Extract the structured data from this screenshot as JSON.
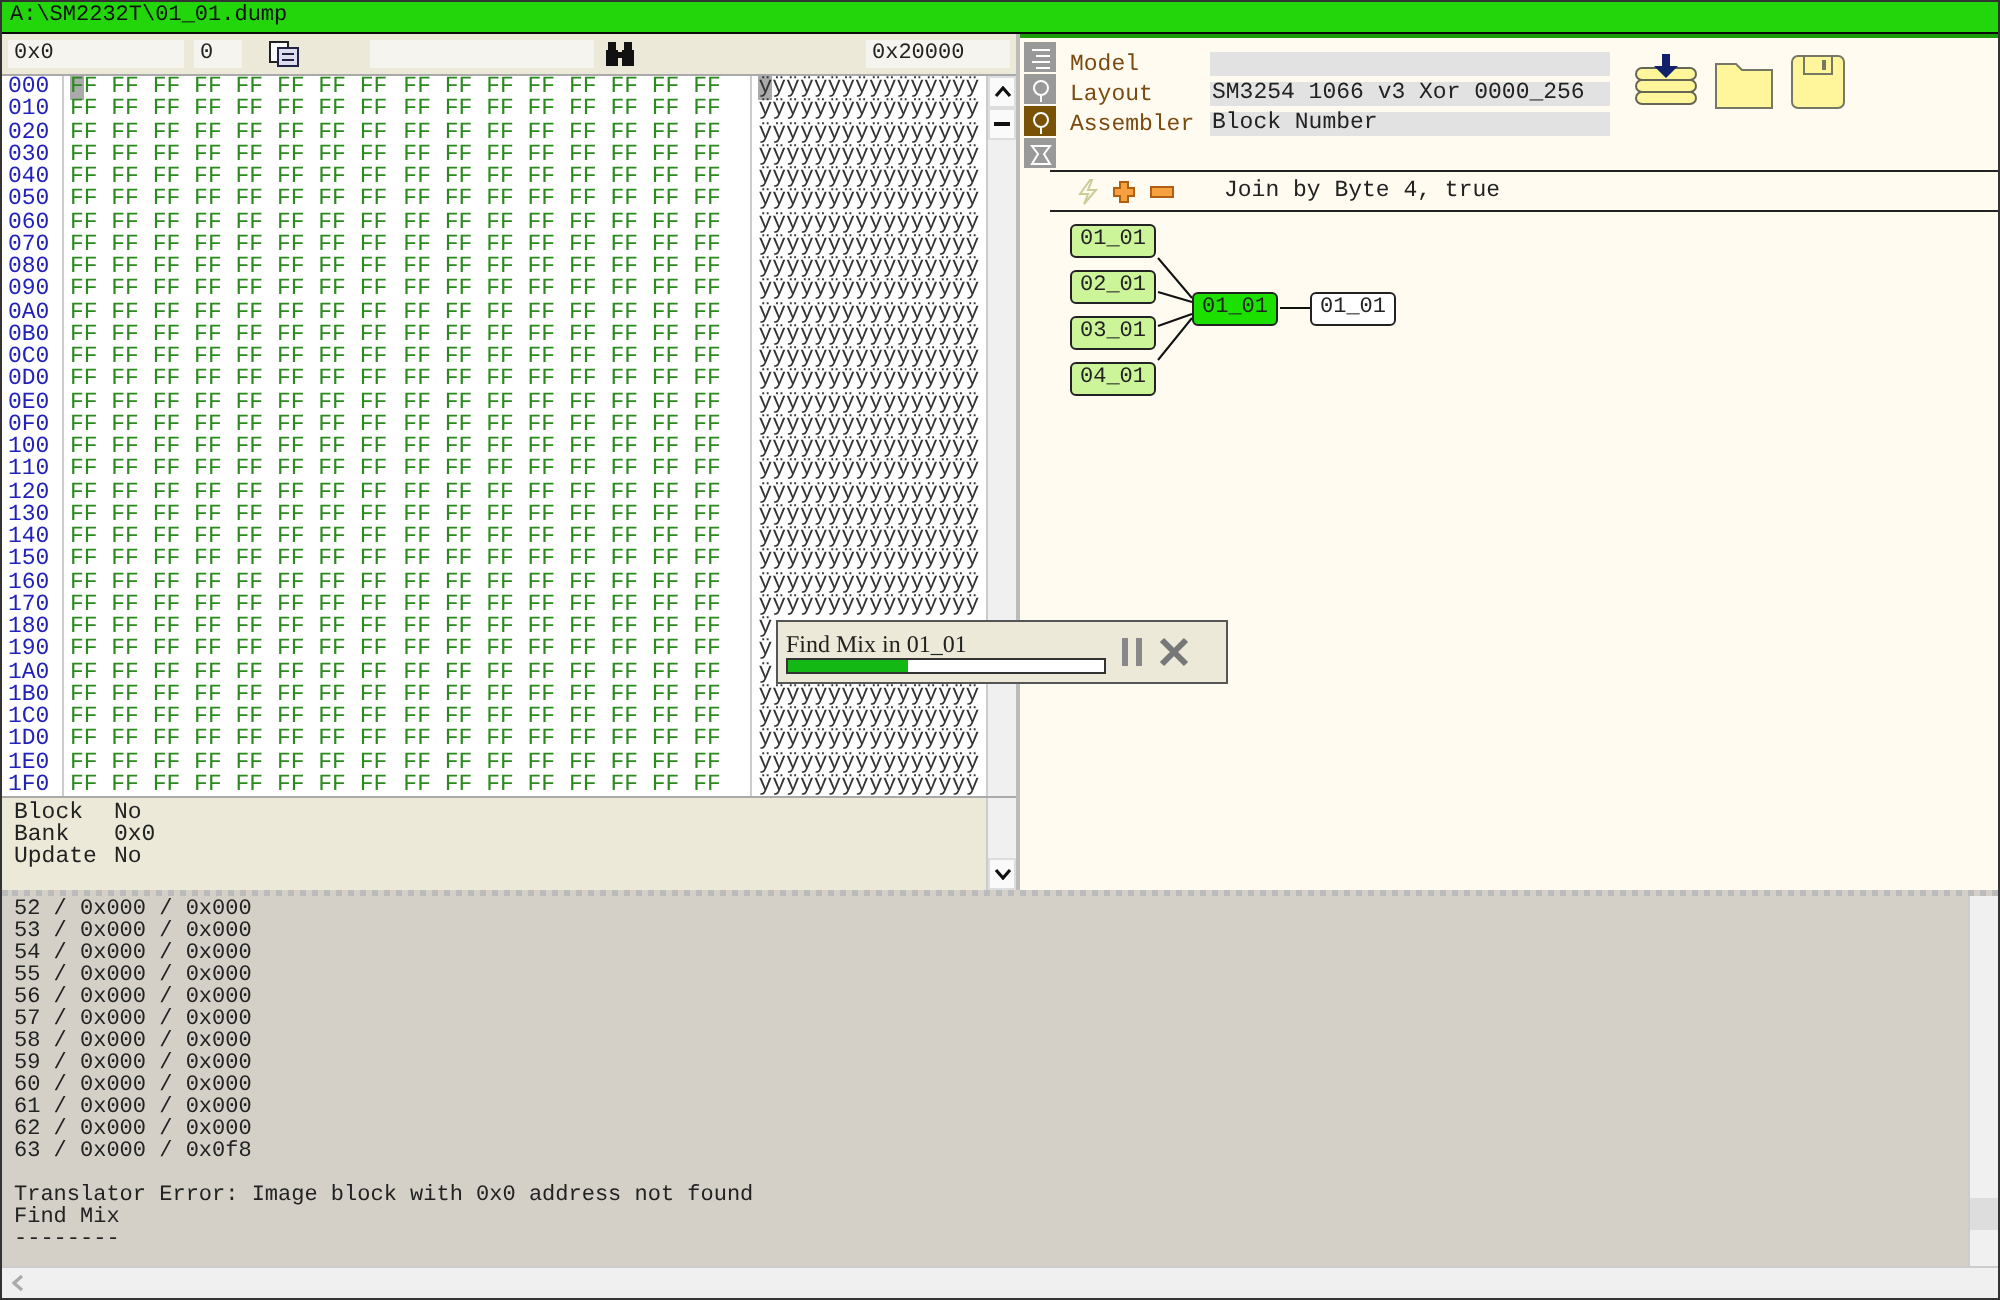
{
  "window": {
    "title": "A:\\SM2232T\\01_01.dump"
  },
  "hex_toolbar": {
    "address": "0x0",
    "value": "0",
    "size": "0x20000"
  },
  "hex_rows": [
    {
      "address": "000",
      "hex_left": "FF FF FF FF FF FF FF FF",
      "hex_right": "FF FF FF FF FF FF FF FF",
      "ascii": "ÿÿÿÿÿÿÿÿÿÿÿÿÿÿÿÿ",
      "cursor": true
    },
    {
      "address": "010",
      "hex_left": "FF FF FF FF FF FF FF FF",
      "hex_right": "FF FF FF FF FF FF FF FF",
      "ascii": "ÿÿÿÿÿÿÿÿÿÿÿÿÿÿÿÿ",
      "cursor": false
    },
    {
      "address": "020",
      "hex_left": "FF FF FF FF FF FF FF FF",
      "hex_right": "FF FF FF FF FF FF FF FF",
      "ascii": "ÿÿÿÿÿÿÿÿÿÿÿÿÿÿÿÿ",
      "cursor": false
    },
    {
      "address": "030",
      "hex_left": "FF FF FF FF FF FF FF FF",
      "hex_right": "FF FF FF FF FF FF FF FF",
      "ascii": "ÿÿÿÿÿÿÿÿÿÿÿÿÿÿÿÿ",
      "cursor": false
    },
    {
      "address": "040",
      "hex_left": "FF FF FF FF FF FF FF FF",
      "hex_right": "FF FF FF FF FF FF FF FF",
      "ascii": "ÿÿÿÿÿÿÿÿÿÿÿÿÿÿÿÿ",
      "cursor": false
    },
    {
      "address": "050",
      "hex_left": "FF FF FF FF FF FF FF FF",
      "hex_right": "FF FF FF FF FF FF FF FF",
      "ascii": "ÿÿÿÿÿÿÿÿÿÿÿÿÿÿÿÿ",
      "cursor": false
    },
    {
      "address": "060",
      "hex_left": "FF FF FF FF FF FF FF FF",
      "hex_right": "FF FF FF FF FF FF FF FF",
      "ascii": "ÿÿÿÿÿÿÿÿÿÿÿÿÿÿÿÿ",
      "cursor": false
    },
    {
      "address": "070",
      "hex_left": "FF FF FF FF FF FF FF FF",
      "hex_right": "FF FF FF FF FF FF FF FF",
      "ascii": "ÿÿÿÿÿÿÿÿÿÿÿÿÿÿÿÿ",
      "cursor": false
    },
    {
      "address": "080",
      "hex_left": "FF FF FF FF FF FF FF FF",
      "hex_right": "FF FF FF FF FF FF FF FF",
      "ascii": "ÿÿÿÿÿÿÿÿÿÿÿÿÿÿÿÿ",
      "cursor": false
    },
    {
      "address": "090",
      "hex_left": "FF FF FF FF FF FF FF FF",
      "hex_right": "FF FF FF FF FF FF FF FF",
      "ascii": "ÿÿÿÿÿÿÿÿÿÿÿÿÿÿÿÿ",
      "cursor": false
    },
    {
      "address": "0A0",
      "hex_left": "FF FF FF FF FF FF FF FF",
      "hex_right": "FF FF FF FF FF FF FF FF",
      "ascii": "ÿÿÿÿÿÿÿÿÿÿÿÿÿÿÿÿ",
      "cursor": false
    },
    {
      "address": "0B0",
      "hex_left": "FF FF FF FF FF FF FF FF",
      "hex_right": "FF FF FF FF FF FF FF FF",
      "ascii": "ÿÿÿÿÿÿÿÿÿÿÿÿÿÿÿÿ",
      "cursor": false
    },
    {
      "address": "0C0",
      "hex_left": "FF FF FF FF FF FF FF FF",
      "hex_right": "FF FF FF FF FF FF FF FF",
      "ascii": "ÿÿÿÿÿÿÿÿÿÿÿÿÿÿÿÿ",
      "cursor": false
    },
    {
      "address": "0D0",
      "hex_left": "FF FF FF FF FF FF FF FF",
      "hex_right": "FF FF FF FF FF FF FF FF",
      "ascii": "ÿÿÿÿÿÿÿÿÿÿÿÿÿÿÿÿ",
      "cursor": false
    },
    {
      "address": "0E0",
      "hex_left": "FF FF FF FF FF FF FF FF",
      "hex_right": "FF FF FF FF FF FF FF FF",
      "ascii": "ÿÿÿÿÿÿÿÿÿÿÿÿÿÿÿÿ",
      "cursor": false
    },
    {
      "address": "0F0",
      "hex_left": "FF FF FF FF FF FF FF FF",
      "hex_right": "FF FF FF FF FF FF FF FF",
      "ascii": "ÿÿÿÿÿÿÿÿÿÿÿÿÿÿÿÿ",
      "cursor": false
    },
    {
      "address": "100",
      "hex_left": "FF FF FF FF FF FF FF FF",
      "hex_right": "FF FF FF FF FF FF FF FF",
      "ascii": "ÿÿÿÿÿÿÿÿÿÿÿÿÿÿÿÿ",
      "cursor": false
    },
    {
      "address": "110",
      "hex_left": "FF FF FF FF FF FF FF FF",
      "hex_right": "FF FF FF FF FF FF FF FF",
      "ascii": "ÿÿÿÿÿÿÿÿÿÿÿÿÿÿÿÿ",
      "cursor": false
    },
    {
      "address": "120",
      "hex_left": "FF FF FF FF FF FF FF FF",
      "hex_right": "FF FF FF FF FF FF FF FF",
      "ascii": "ÿÿÿÿÿÿÿÿÿÿÿÿÿÿÿÿ",
      "cursor": false
    },
    {
      "address": "130",
      "hex_left": "FF FF FF FF FF FF FF FF",
      "hex_right": "FF FF FF FF FF FF FF FF",
      "ascii": "ÿÿÿÿÿÿÿÿÿÿÿÿÿÿÿÿ",
      "cursor": false
    },
    {
      "address": "140",
      "hex_left": "FF FF FF FF FF FF FF FF",
      "hex_right": "FF FF FF FF FF FF FF FF",
      "ascii": "ÿÿÿÿÿÿÿÿÿÿÿÿÿÿÿÿ",
      "cursor": false
    },
    {
      "address": "150",
      "hex_left": "FF FF FF FF FF FF FF FF",
      "hex_right": "FF FF FF FF FF FF FF FF",
      "ascii": "ÿÿÿÿÿÿÿÿÿÿÿÿÿÿÿÿ",
      "cursor": false
    },
    {
      "address": "160",
      "hex_left": "FF FF FF FF FF FF FF FF",
      "hex_right": "FF FF FF FF FF FF FF FF",
      "ascii": "ÿÿÿÿÿÿÿÿÿÿÿÿÿÿÿÿ",
      "cursor": false
    },
    {
      "address": "170",
      "hex_left": "FF FF FF FF FF FF FF FF",
      "hex_right": "FF FF FF FF FF FF FF FF",
      "ascii": "ÿÿÿÿÿÿÿÿÿÿÿÿÿÿÿÿ",
      "cursor": false
    },
    {
      "address": "180",
      "hex_left": "FF FF FF FF FF FF FF FF",
      "hex_right": "FF FF FF FF FF FF FF FF",
      "ascii": "ÿ",
      "cursor": false
    },
    {
      "address": "190",
      "hex_left": "FF FF FF FF FF FF FF FF",
      "hex_right": "FF FF FF FF FF FF FF FF",
      "ascii": "ÿ",
      "cursor": false
    },
    {
      "address": "1A0",
      "hex_left": "FF FF FF FF FF FF FF FF",
      "hex_right": "FF FF FF FF FF FF FF FF",
      "ascii": "ÿ",
      "cursor": false
    },
    {
      "address": "1B0",
      "hex_left": "FF FF FF FF FF FF FF FF",
      "hex_right": "FF FF FF FF FF FF FF FF",
      "ascii": "ÿÿÿÿÿÿÿÿÿÿÿÿÿÿÿÿ",
      "cursor": false
    },
    {
      "address": "1C0",
      "hex_left": "FF FF FF FF FF FF FF FF",
      "hex_right": "FF FF FF FF FF FF FF FF",
      "ascii": "ÿÿÿÿÿÿÿÿÿÿÿÿÿÿÿÿ",
      "cursor": false
    },
    {
      "address": "1D0",
      "hex_left": "FF FF FF FF FF FF FF FF",
      "hex_right": "FF FF FF FF FF FF FF FF",
      "ascii": "ÿÿÿÿÿÿÿÿÿÿÿÿÿÿÿÿ",
      "cursor": false
    },
    {
      "address": "1E0",
      "hex_left": "FF FF FF FF FF FF FF FF",
      "hex_right": "FF FF FF FF FF FF FF FF",
      "ascii": "ÿÿÿÿÿÿÿÿÿÿÿÿÿÿÿÿ",
      "cursor": false
    },
    {
      "address": "1F0",
      "hex_left": "FF FF FF FF FF FF FF FF",
      "hex_right": "FF FF FF FF FF FF FF FF",
      "ascii": "ÿÿÿÿÿÿÿÿÿÿÿÿÿÿÿÿ",
      "cursor": false
    }
  ],
  "info": [
    {
      "label": "Block",
      "value": "No"
    },
    {
      "label": "Bank",
      "value": "0x0"
    },
    {
      "label": "Update",
      "value": "No"
    }
  ],
  "side_tabs": [
    {
      "selected": false
    },
    {
      "selected": false
    },
    {
      "selected": true
    },
    {
      "selected": false
    }
  ],
  "properties": [
    {
      "label": "Model"
    },
    {
      "label": "Layout",
      "value": "SM3254 1066 v3 Xor 0000_256"
    },
    {
      "label": "Assembler",
      "value": "Block Number"
    }
  ],
  "join_text": "Join by Byte 4, true",
  "nodes": [
    {
      "label": "01_01",
      "kind": "input"
    },
    {
      "label": "02_01",
      "kind": "input"
    },
    {
      "label": "03_01",
      "kind": "input"
    },
    {
      "label": "04_01",
      "kind": "input"
    },
    {
      "label": "01_01",
      "kind": "merge"
    },
    {
      "label": "01_01",
      "kind": "output"
    }
  ],
  "progress": {
    "title": "Find Mix in 01_01",
    "level": 0.38
  },
  "log": [
    {
      "text": "52 / 0x000 / 0x000",
      "gap_before": false
    },
    {
      "text": "53 / 0x000 / 0x000",
      "gap_before": false
    },
    {
      "text": "54 / 0x000 / 0x000",
      "gap_before": false
    },
    {
      "text": "55 / 0x000 / 0x000",
      "gap_before": false
    },
    {
      "text": "56 / 0x000 / 0x000",
      "gap_before": false
    },
    {
      "text": "57 / 0x000 / 0x000",
      "gap_before": false
    },
    {
      "text": "58 / 0x000 / 0x000",
      "gap_before": false
    },
    {
      "text": "59 / 0x000 / 0x000",
      "gap_before": false
    },
    {
      "text": "60 / 0x000 / 0x000",
      "gap_before": false
    },
    {
      "text": "61 / 0x000 / 0x000",
      "gap_before": false
    },
    {
      "text": "62 / 0x000 / 0x000",
      "gap_before": false
    },
    {
      "text": "63 / 0x000 / 0x0f8",
      "gap_before": false
    },
    {
      "text": "Translator Error: Image block with 0x0 address not found",
      "gap_before": true
    },
    {
      "text": "Find Mix",
      "gap_before": false
    },
    {
      "text": "--------",
      "gap_before": false
    }
  ]
}
